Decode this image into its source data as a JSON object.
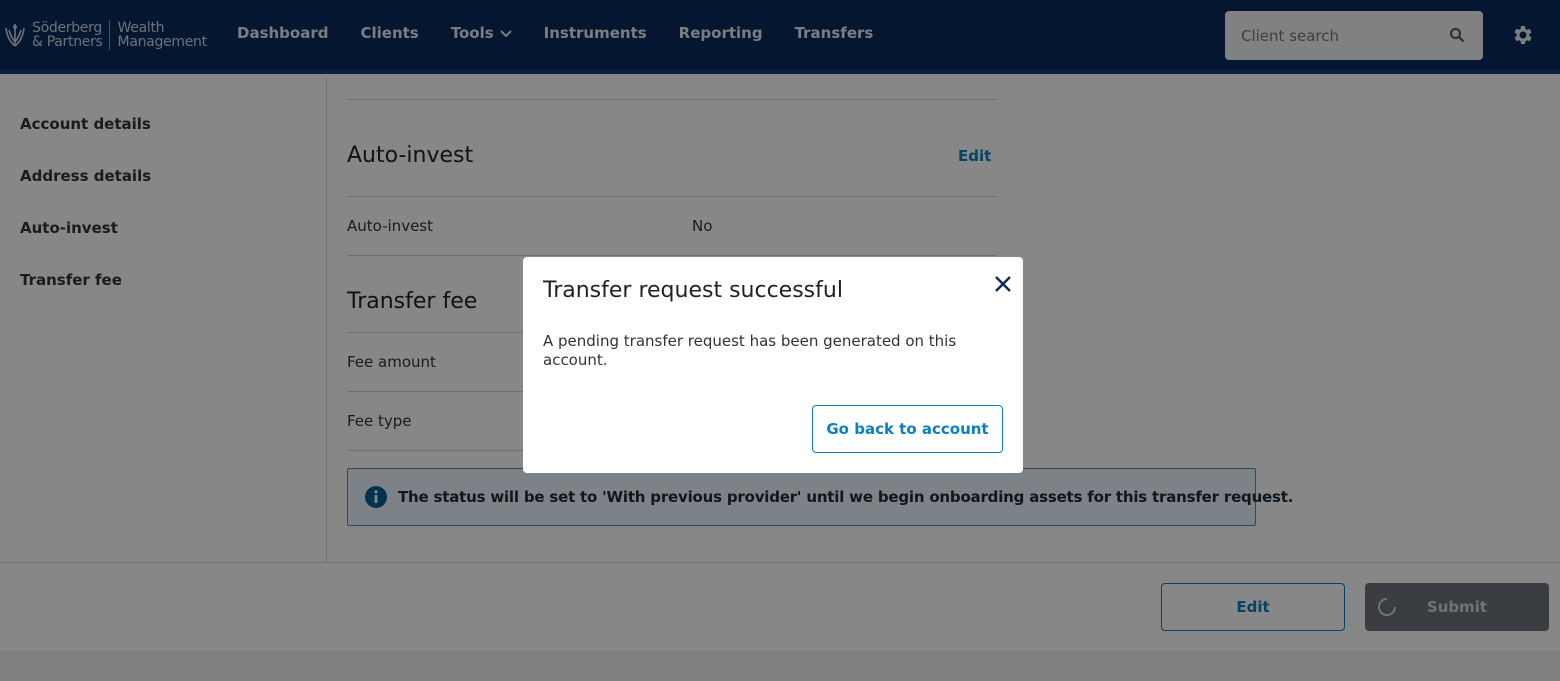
{
  "header": {
    "brand_name_line1": "Söderberg",
    "brand_name_line2": "& Partners",
    "brand_sub_line1": "Wealth",
    "brand_sub_line2": "Management",
    "nav": {
      "dashboard": "Dashboard",
      "clients": "Clients",
      "tools": "Tools",
      "instruments": "Instruments",
      "reporting": "Reporting",
      "transfers": "Transfers"
    },
    "search_placeholder": "Client search"
  },
  "sidebar": {
    "items": [
      "Account details",
      "Address details",
      "Auto-invest",
      "Transfer fee"
    ]
  },
  "main": {
    "auto_invest": {
      "title": "Auto-invest",
      "edit_label": "Edit",
      "rows": [
        {
          "label": "Auto-invest",
          "value": "No"
        }
      ]
    },
    "transfer_fee": {
      "title": "Transfer fee",
      "rows": [
        {
          "label": "Fee amount",
          "value": ""
        },
        {
          "label": "Fee type",
          "value": ""
        }
      ]
    },
    "info_message": "The status will be set to 'With previous provider' until we begin onboarding assets for this transfer request."
  },
  "footer": {
    "edit_label": "Edit",
    "submit_label": "Submit"
  },
  "modal": {
    "title": "Transfer request successful",
    "body": "A pending transfer request has been generated on this account.",
    "button_label": "Go back to account"
  },
  "colors": {
    "header_bg": "#0b2a5b",
    "accent": "#0a7fc2"
  }
}
